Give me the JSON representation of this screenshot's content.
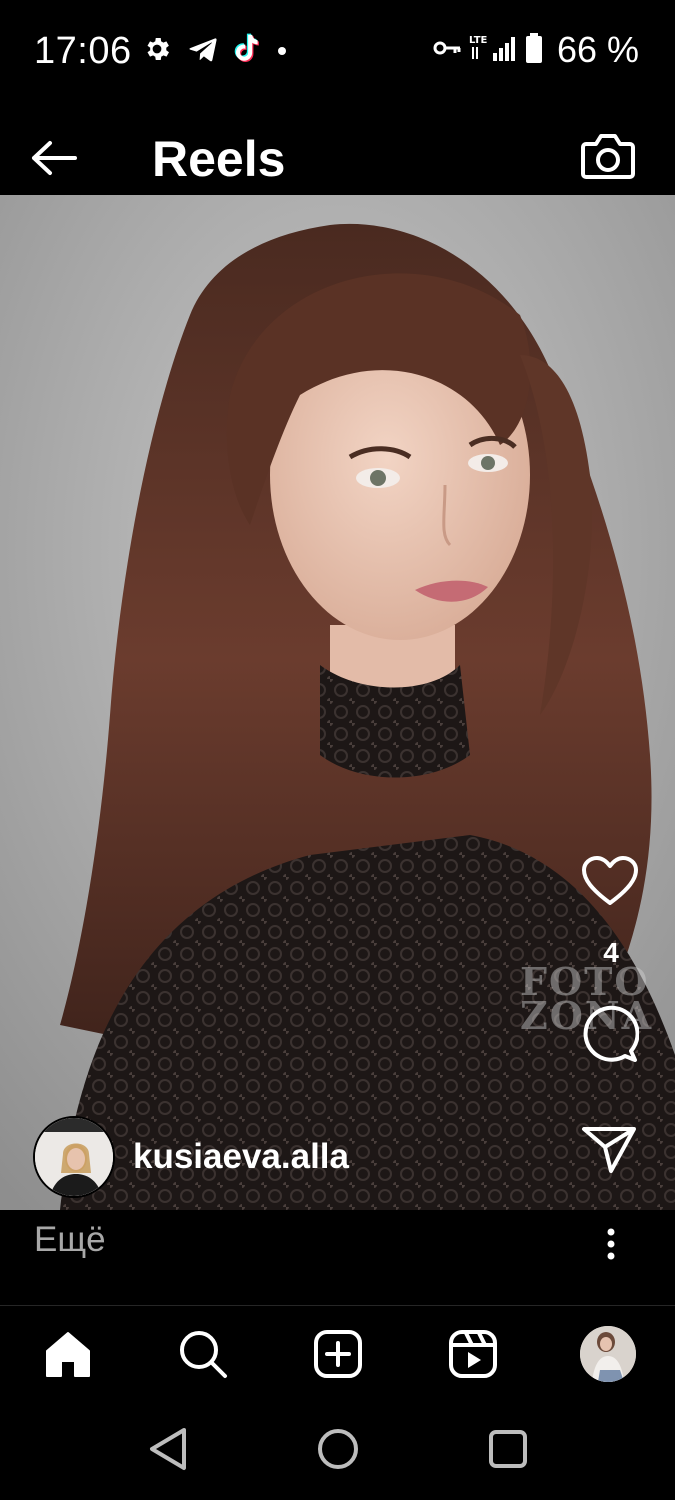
{
  "status_bar": {
    "time": "17:06",
    "battery_text": "66 %",
    "icons": [
      "settings-icon",
      "telegram-icon",
      "tiktok-icon",
      "notification-dot",
      "vpn-key-icon",
      "lte-signal-icon",
      "battery-icon"
    ]
  },
  "header": {
    "title": "Reels",
    "back_icon": "arrow-left-icon",
    "camera_icon": "camera-icon"
  },
  "reel": {
    "watermark_line1": "FOTO",
    "watermark_line2": "ZONA",
    "like_count": "4",
    "author_name": "kusiaeva.alla"
  },
  "caption": {
    "more_label": "Ещё"
  },
  "bottom_nav": {
    "items": [
      "home-icon",
      "search-icon",
      "create-icon",
      "reels-icon",
      "profile-avatar"
    ]
  },
  "android_nav": {
    "items": [
      "back-triangle",
      "home-circle",
      "recents-square"
    ]
  },
  "colors": {
    "background": "#000000",
    "text_primary": "#ffffff",
    "text_secondary": "#a8a8a8",
    "tiktok_cyan": "#25f4ee",
    "tiktok_pink": "#fe2c55"
  }
}
